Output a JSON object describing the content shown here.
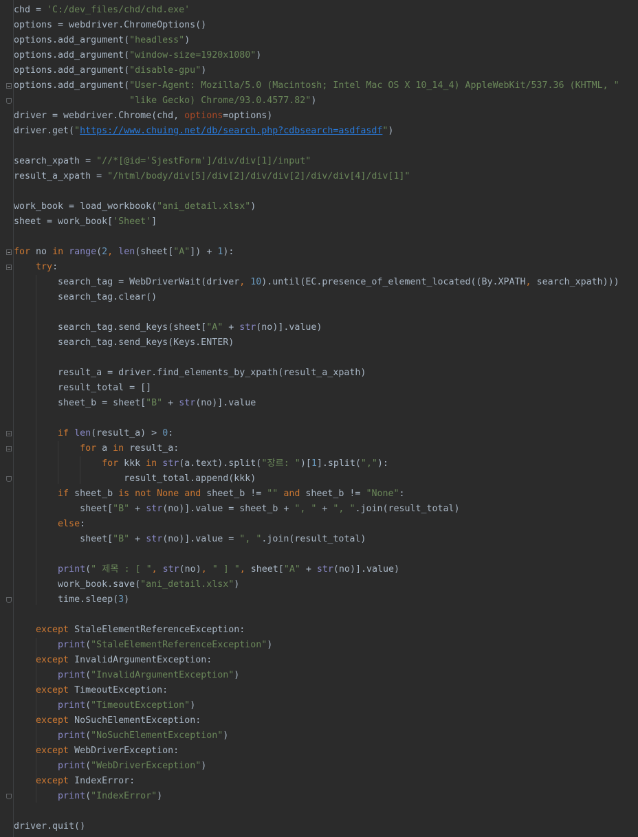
{
  "editor": {
    "language": "python",
    "lines": [
      {
        "indent": 0,
        "tokens": [
          [
            "t",
            "chd = "
          ],
          [
            "str",
            "'C:/dev_files/chd/chd.exe'"
          ]
        ]
      },
      {
        "indent": 0,
        "tokens": [
          [
            "t",
            "options = webdriver.ChromeOptions()"
          ]
        ]
      },
      {
        "indent": 0,
        "tokens": [
          [
            "t",
            "options.add_argument("
          ],
          [
            "str",
            "\"headless\""
          ],
          [
            "t",
            ")"
          ]
        ]
      },
      {
        "indent": 0,
        "tokens": [
          [
            "t",
            "options.add_argument("
          ],
          [
            "str",
            "\"window-size=1920x1080\""
          ],
          [
            "t",
            ")"
          ]
        ]
      },
      {
        "indent": 0,
        "tokens": [
          [
            "t",
            "options.add_argument("
          ],
          [
            "str",
            "\"disable-gpu\""
          ],
          [
            "t",
            ")"
          ]
        ]
      },
      {
        "indent": 0,
        "tokens": [
          [
            "t",
            "options.add_argument("
          ],
          [
            "str",
            "\"User-Agent: Mozilla/5.0 (Macintosh; Intel Mac OS X 10_14_4) AppleWebKit/537.36 (KHTML, \""
          ]
        ]
      },
      {
        "indent": 21,
        "tokens": [
          [
            "str",
            "\"like Gecko) Chrome/93.0.4577.82\""
          ],
          [
            "t",
            ")"
          ]
        ]
      },
      {
        "indent": 0,
        "tokens": [
          [
            "t",
            "driver = webdriver.Chrome(chd, "
          ],
          [
            "par",
            "options"
          ],
          [
            "t",
            "=options)"
          ]
        ]
      },
      {
        "indent": 0,
        "tokens": [
          [
            "t",
            "driver.get("
          ],
          [
            "str",
            "\""
          ],
          [
            "lnk",
            "https://www.chuing.net/db/search.php?cdbsearch=asdfasdf"
          ],
          [
            "str",
            "\""
          ],
          [
            "t",
            ")"
          ]
        ]
      },
      {
        "indent": 0,
        "tokens": []
      },
      {
        "indent": 0,
        "tokens": [
          [
            "t",
            "search_xpath = "
          ],
          [
            "str",
            "\"//*[@id='SjestForm']/div/div[1]/input\""
          ]
        ]
      },
      {
        "indent": 0,
        "tokens": [
          [
            "t",
            "result_a_xpath = "
          ],
          [
            "str",
            "\"/html/body/div[5]/div[2]/div/div[2]/div/div[4]/div[1]\""
          ]
        ]
      },
      {
        "indent": 0,
        "tokens": []
      },
      {
        "indent": 0,
        "tokens": [
          [
            "t",
            "work_book = load_workbook("
          ],
          [
            "str",
            "\"ani_detail.xlsx\""
          ],
          [
            "t",
            ")"
          ]
        ]
      },
      {
        "indent": 0,
        "tokens": [
          [
            "t",
            "sheet = work_book["
          ],
          [
            "str",
            "'Sheet'"
          ],
          [
            "t",
            "]"
          ]
        ]
      },
      {
        "indent": 0,
        "tokens": []
      },
      {
        "indent": 0,
        "tokens": [
          [
            "kw",
            "for"
          ],
          [
            "t",
            " no "
          ],
          [
            "kw",
            "in"
          ],
          [
            "t",
            " "
          ],
          [
            "bi",
            "range"
          ],
          [
            "t",
            "("
          ],
          [
            "num",
            "2"
          ],
          [
            "kw",
            ","
          ],
          [
            "t",
            " "
          ],
          [
            "bi",
            "len"
          ],
          [
            "t",
            "(sheet["
          ],
          [
            "str",
            "\"A\""
          ],
          [
            "t",
            "]) + "
          ],
          [
            "num",
            "1"
          ],
          [
            "t",
            "):"
          ]
        ]
      },
      {
        "indent": 4,
        "tokens": [
          [
            "kw",
            "try"
          ],
          [
            "t",
            ":"
          ]
        ]
      },
      {
        "indent": 8,
        "tokens": [
          [
            "t",
            "search_tag = WebDriverWait(driver"
          ],
          [
            "kw",
            ","
          ],
          [
            "t",
            " "
          ],
          [
            "num",
            "10"
          ],
          [
            "t",
            ").until(EC.presence_of_element_located((By.XPATH"
          ],
          [
            "kw",
            ","
          ],
          [
            "t",
            " search_xpath)))"
          ]
        ]
      },
      {
        "indent": 8,
        "tokens": [
          [
            "t",
            "search_tag.clear()"
          ]
        ]
      },
      {
        "indent": 0,
        "tokens": []
      },
      {
        "indent": 8,
        "tokens": [
          [
            "t",
            "search_tag.send_keys(sheet["
          ],
          [
            "str",
            "\"A\""
          ],
          [
            "t",
            " + "
          ],
          [
            "bi",
            "str"
          ],
          [
            "t",
            "(no)].value)"
          ]
        ]
      },
      {
        "indent": 8,
        "tokens": [
          [
            "t",
            "search_tag.send_keys(Keys.ENTER)"
          ]
        ]
      },
      {
        "indent": 0,
        "tokens": []
      },
      {
        "indent": 8,
        "tokens": [
          [
            "t",
            "result_a = driver.find_elements_by_xpath(result_a_xpath)"
          ]
        ]
      },
      {
        "indent": 8,
        "tokens": [
          [
            "t",
            "result_total = []"
          ]
        ]
      },
      {
        "indent": 8,
        "tokens": [
          [
            "t",
            "sheet_b = sheet["
          ],
          [
            "str",
            "\"B\""
          ],
          [
            "t",
            " + "
          ],
          [
            "bi",
            "str"
          ],
          [
            "t",
            "(no)].value"
          ]
        ]
      },
      {
        "indent": 0,
        "tokens": []
      },
      {
        "indent": 8,
        "tokens": [
          [
            "kw",
            "if"
          ],
          [
            "t",
            " "
          ],
          [
            "bi",
            "len"
          ],
          [
            "t",
            "(result_a) > "
          ],
          [
            "num",
            "0"
          ],
          [
            "t",
            ":"
          ]
        ]
      },
      {
        "indent": 12,
        "tokens": [
          [
            "kw",
            "for"
          ],
          [
            "t",
            " a "
          ],
          [
            "kw",
            "in"
          ],
          [
            "t",
            " result_a:"
          ]
        ]
      },
      {
        "indent": 16,
        "tokens": [
          [
            "kw",
            "for"
          ],
          [
            "t",
            " kkk "
          ],
          [
            "kw",
            "in"
          ],
          [
            "t",
            " "
          ],
          [
            "bi",
            "str"
          ],
          [
            "t",
            "(a.text).split("
          ],
          [
            "str",
            "\"장르: \""
          ],
          [
            "t",
            ")["
          ],
          [
            "num",
            "1"
          ],
          [
            "t",
            "].split("
          ],
          [
            "str",
            "\",\""
          ],
          [
            "t",
            "):"
          ]
        ]
      },
      {
        "indent": 20,
        "tokens": [
          [
            "t",
            "result_total.append(kkk)"
          ]
        ]
      },
      {
        "indent": 8,
        "tokens": [
          [
            "kw",
            "if"
          ],
          [
            "t",
            " sheet_b "
          ],
          [
            "kw",
            "is not None and"
          ],
          [
            "t",
            " sheet_b != "
          ],
          [
            "str",
            "\"\""
          ],
          [
            "t",
            " "
          ],
          [
            "kw",
            "and"
          ],
          [
            "t",
            " sheet_b != "
          ],
          [
            "str",
            "\"None\""
          ],
          [
            "t",
            ":"
          ]
        ]
      },
      {
        "indent": 12,
        "tokens": [
          [
            "t",
            "sheet["
          ],
          [
            "str",
            "\"B\""
          ],
          [
            "t",
            " + "
          ],
          [
            "bi",
            "str"
          ],
          [
            "t",
            "(no)].value = sheet_b + "
          ],
          [
            "str",
            "\", \""
          ],
          [
            "t",
            " + "
          ],
          [
            "str",
            "\", \""
          ],
          [
            "t",
            ".join(result_total)"
          ]
        ]
      },
      {
        "indent": 8,
        "tokens": [
          [
            "kw",
            "else"
          ],
          [
            "t",
            ":"
          ]
        ]
      },
      {
        "indent": 12,
        "tokens": [
          [
            "t",
            "sheet["
          ],
          [
            "str",
            "\"B\""
          ],
          [
            "t",
            " + "
          ],
          [
            "bi",
            "str"
          ],
          [
            "t",
            "(no)].value = "
          ],
          [
            "str",
            "\", \""
          ],
          [
            "t",
            ".join(result_total)"
          ]
        ]
      },
      {
        "indent": 0,
        "tokens": []
      },
      {
        "indent": 8,
        "tokens": [
          [
            "bi",
            "print"
          ],
          [
            "t",
            "("
          ],
          [
            "str",
            "\" 제목 : [ \""
          ],
          [
            "kw",
            ","
          ],
          [
            "t",
            " "
          ],
          [
            "bi",
            "str"
          ],
          [
            "t",
            "(no)"
          ],
          [
            "kw",
            ","
          ],
          [
            "t",
            " "
          ],
          [
            "str",
            "\" ] \""
          ],
          [
            "kw",
            ","
          ],
          [
            "t",
            " sheet["
          ],
          [
            "str",
            "\"A\""
          ],
          [
            "t",
            " + "
          ],
          [
            "bi",
            "str"
          ],
          [
            "t",
            "(no)].value)"
          ]
        ]
      },
      {
        "indent": 8,
        "tokens": [
          [
            "t",
            "work_book.save("
          ],
          [
            "str",
            "\"ani_detail.xlsx\""
          ],
          [
            "t",
            ")"
          ]
        ]
      },
      {
        "indent": 8,
        "tokens": [
          [
            "t",
            "time.sleep("
          ],
          [
            "num",
            "3"
          ],
          [
            "t",
            ")"
          ]
        ]
      },
      {
        "indent": 0,
        "tokens": []
      },
      {
        "indent": 4,
        "tokens": [
          [
            "kw",
            "except"
          ],
          [
            "t",
            " StaleElementReferenceException:"
          ]
        ]
      },
      {
        "indent": 8,
        "tokens": [
          [
            "bi",
            "print"
          ],
          [
            "t",
            "("
          ],
          [
            "str",
            "\"StaleElementReferenceException\""
          ],
          [
            "t",
            ")"
          ]
        ]
      },
      {
        "indent": 4,
        "tokens": [
          [
            "kw",
            "except"
          ],
          [
            "t",
            " InvalidArgumentException:"
          ]
        ]
      },
      {
        "indent": 8,
        "tokens": [
          [
            "bi",
            "print"
          ],
          [
            "t",
            "("
          ],
          [
            "str",
            "\"InvalidArgumentException\""
          ],
          [
            "t",
            ")"
          ]
        ]
      },
      {
        "indent": 4,
        "tokens": [
          [
            "kw",
            "except"
          ],
          [
            "t",
            " TimeoutException:"
          ]
        ]
      },
      {
        "indent": 8,
        "tokens": [
          [
            "bi",
            "print"
          ],
          [
            "t",
            "("
          ],
          [
            "str",
            "\"TimeoutException\""
          ],
          [
            "t",
            ")"
          ]
        ]
      },
      {
        "indent": 4,
        "tokens": [
          [
            "kw",
            "except"
          ],
          [
            "t",
            " NoSuchElementException:"
          ]
        ]
      },
      {
        "indent": 8,
        "tokens": [
          [
            "bi",
            "print"
          ],
          [
            "t",
            "("
          ],
          [
            "str",
            "\"NoSuchElementException\""
          ],
          [
            "t",
            ")"
          ]
        ]
      },
      {
        "indent": 4,
        "tokens": [
          [
            "kw",
            "except"
          ],
          [
            "t",
            " WebDriverException:"
          ]
        ]
      },
      {
        "indent": 8,
        "tokens": [
          [
            "bi",
            "print"
          ],
          [
            "t",
            "("
          ],
          [
            "str",
            "\"WebDriverException\""
          ],
          [
            "t",
            ")"
          ]
        ]
      },
      {
        "indent": 4,
        "tokens": [
          [
            "kw",
            "except"
          ],
          [
            "t",
            " IndexError:"
          ]
        ]
      },
      {
        "indent": 8,
        "tokens": [
          [
            "bi",
            "print"
          ],
          [
            "t",
            "("
          ],
          [
            "str",
            "\"IndexError\""
          ],
          [
            "t",
            ")"
          ]
        ]
      },
      {
        "indent": 0,
        "tokens": []
      },
      {
        "indent": 0,
        "tokens": [
          [
            "t",
            "driver.quit()"
          ]
        ]
      }
    ],
    "colors": {
      "background": "#2b2b2b",
      "text": "#a9b7c6",
      "keyword": "#cc7832",
      "string": "#6a8759",
      "number": "#6897bb",
      "builtin": "#8888c6",
      "parameter": "#aa4926",
      "link": "#287bde"
    }
  }
}
